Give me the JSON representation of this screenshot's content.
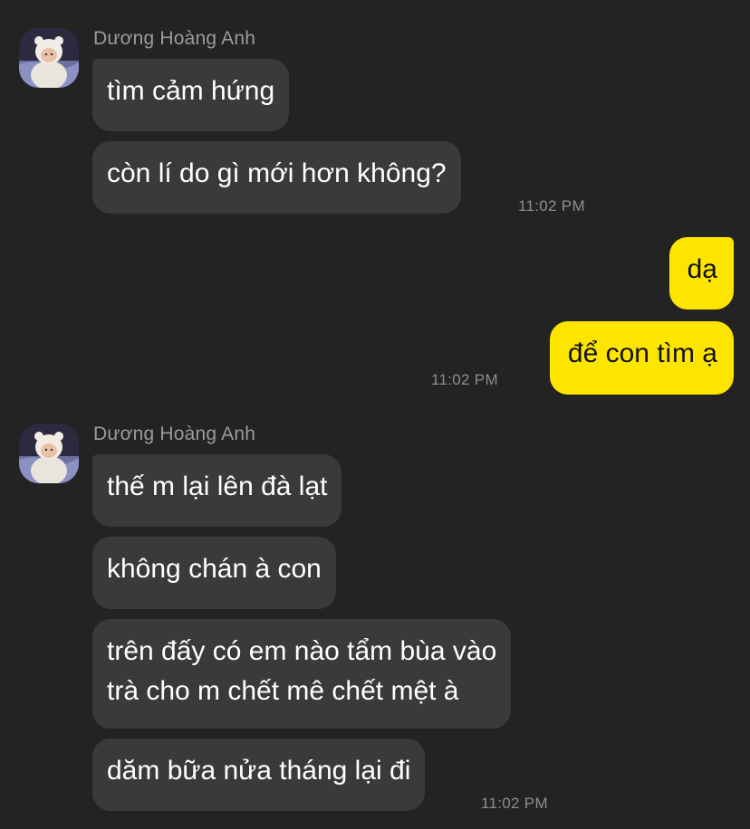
{
  "group1": {
    "sender": "Dương Hoàng Anh",
    "messages": [
      "tìm cảm hứng",
      "còn lí do gì mới hơn không?"
    ],
    "time": "11:02 PM"
  },
  "outgoing": {
    "messages": [
      "dạ",
      "để con tìm ạ"
    ],
    "time": "11:02 PM"
  },
  "group2": {
    "sender": "Dương Hoàng Anh",
    "messages": [
      "thế m lại lên đà lạt",
      "không chán à con",
      "trên đấy có em nào tẩm bùa vào",
      "trà cho m chết mê chết mệt à",
      "dăm bữa nửa tháng lại đi"
    ],
    "time": "11:02 PM"
  },
  "colors": {
    "background": "#232324",
    "incoming_bubble": "#3a3a3c",
    "outgoing_bubble": "#fee500"
  }
}
